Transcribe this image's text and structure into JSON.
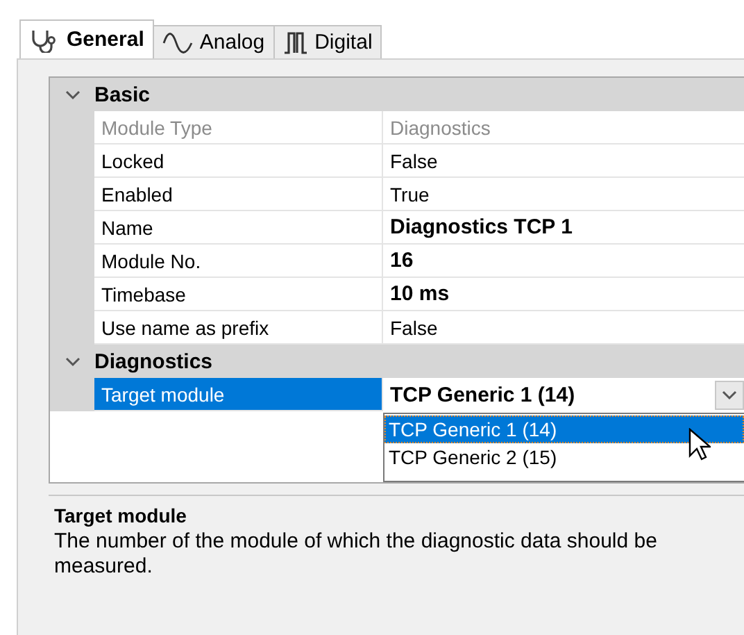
{
  "tabs": [
    {
      "label": "General",
      "kind": "stethoscope",
      "selected": true
    },
    {
      "label": "Analog",
      "kind": "wave",
      "selected": false
    },
    {
      "label": "Digital",
      "kind": "pulse",
      "selected": false
    }
  ],
  "categories": [
    {
      "title": "Basic",
      "expanded": true,
      "rows": [
        {
          "name": "Module Type",
          "value": "Diagnostics",
          "readonly": true,
          "modified": false,
          "selected": false
        },
        {
          "name": "Locked",
          "value": "False",
          "readonly": false,
          "modified": false,
          "selected": false
        },
        {
          "name": "Enabled",
          "value": "True",
          "readonly": false,
          "modified": false,
          "selected": false
        },
        {
          "name": "Name",
          "value": "Diagnostics TCP 1",
          "readonly": false,
          "modified": true,
          "selected": false
        },
        {
          "name": "Module No.",
          "value": "16",
          "readonly": false,
          "modified": true,
          "selected": false
        },
        {
          "name": "Timebase",
          "value": "10 ms",
          "readonly": false,
          "modified": true,
          "selected": false
        },
        {
          "name": "Use name as prefix",
          "value": "False",
          "readonly": false,
          "modified": false,
          "selected": false
        }
      ]
    },
    {
      "title": "Diagnostics",
      "expanded": true,
      "rows": [
        {
          "name": "Target module",
          "value": "TCP Generic 1 (14)",
          "readonly": false,
          "modified": true,
          "selected": true,
          "dropdown": {
            "expanded": true,
            "options": [
              {
                "label": "TCP Generic 1 (14)",
                "selected": true
              },
              {
                "label": "TCP Generic 2 (15)",
                "selected": false
              }
            ]
          }
        }
      ]
    }
  ],
  "description": {
    "title": "Target module",
    "text": "The number of the module of which the diagnostic data should be measured."
  }
}
